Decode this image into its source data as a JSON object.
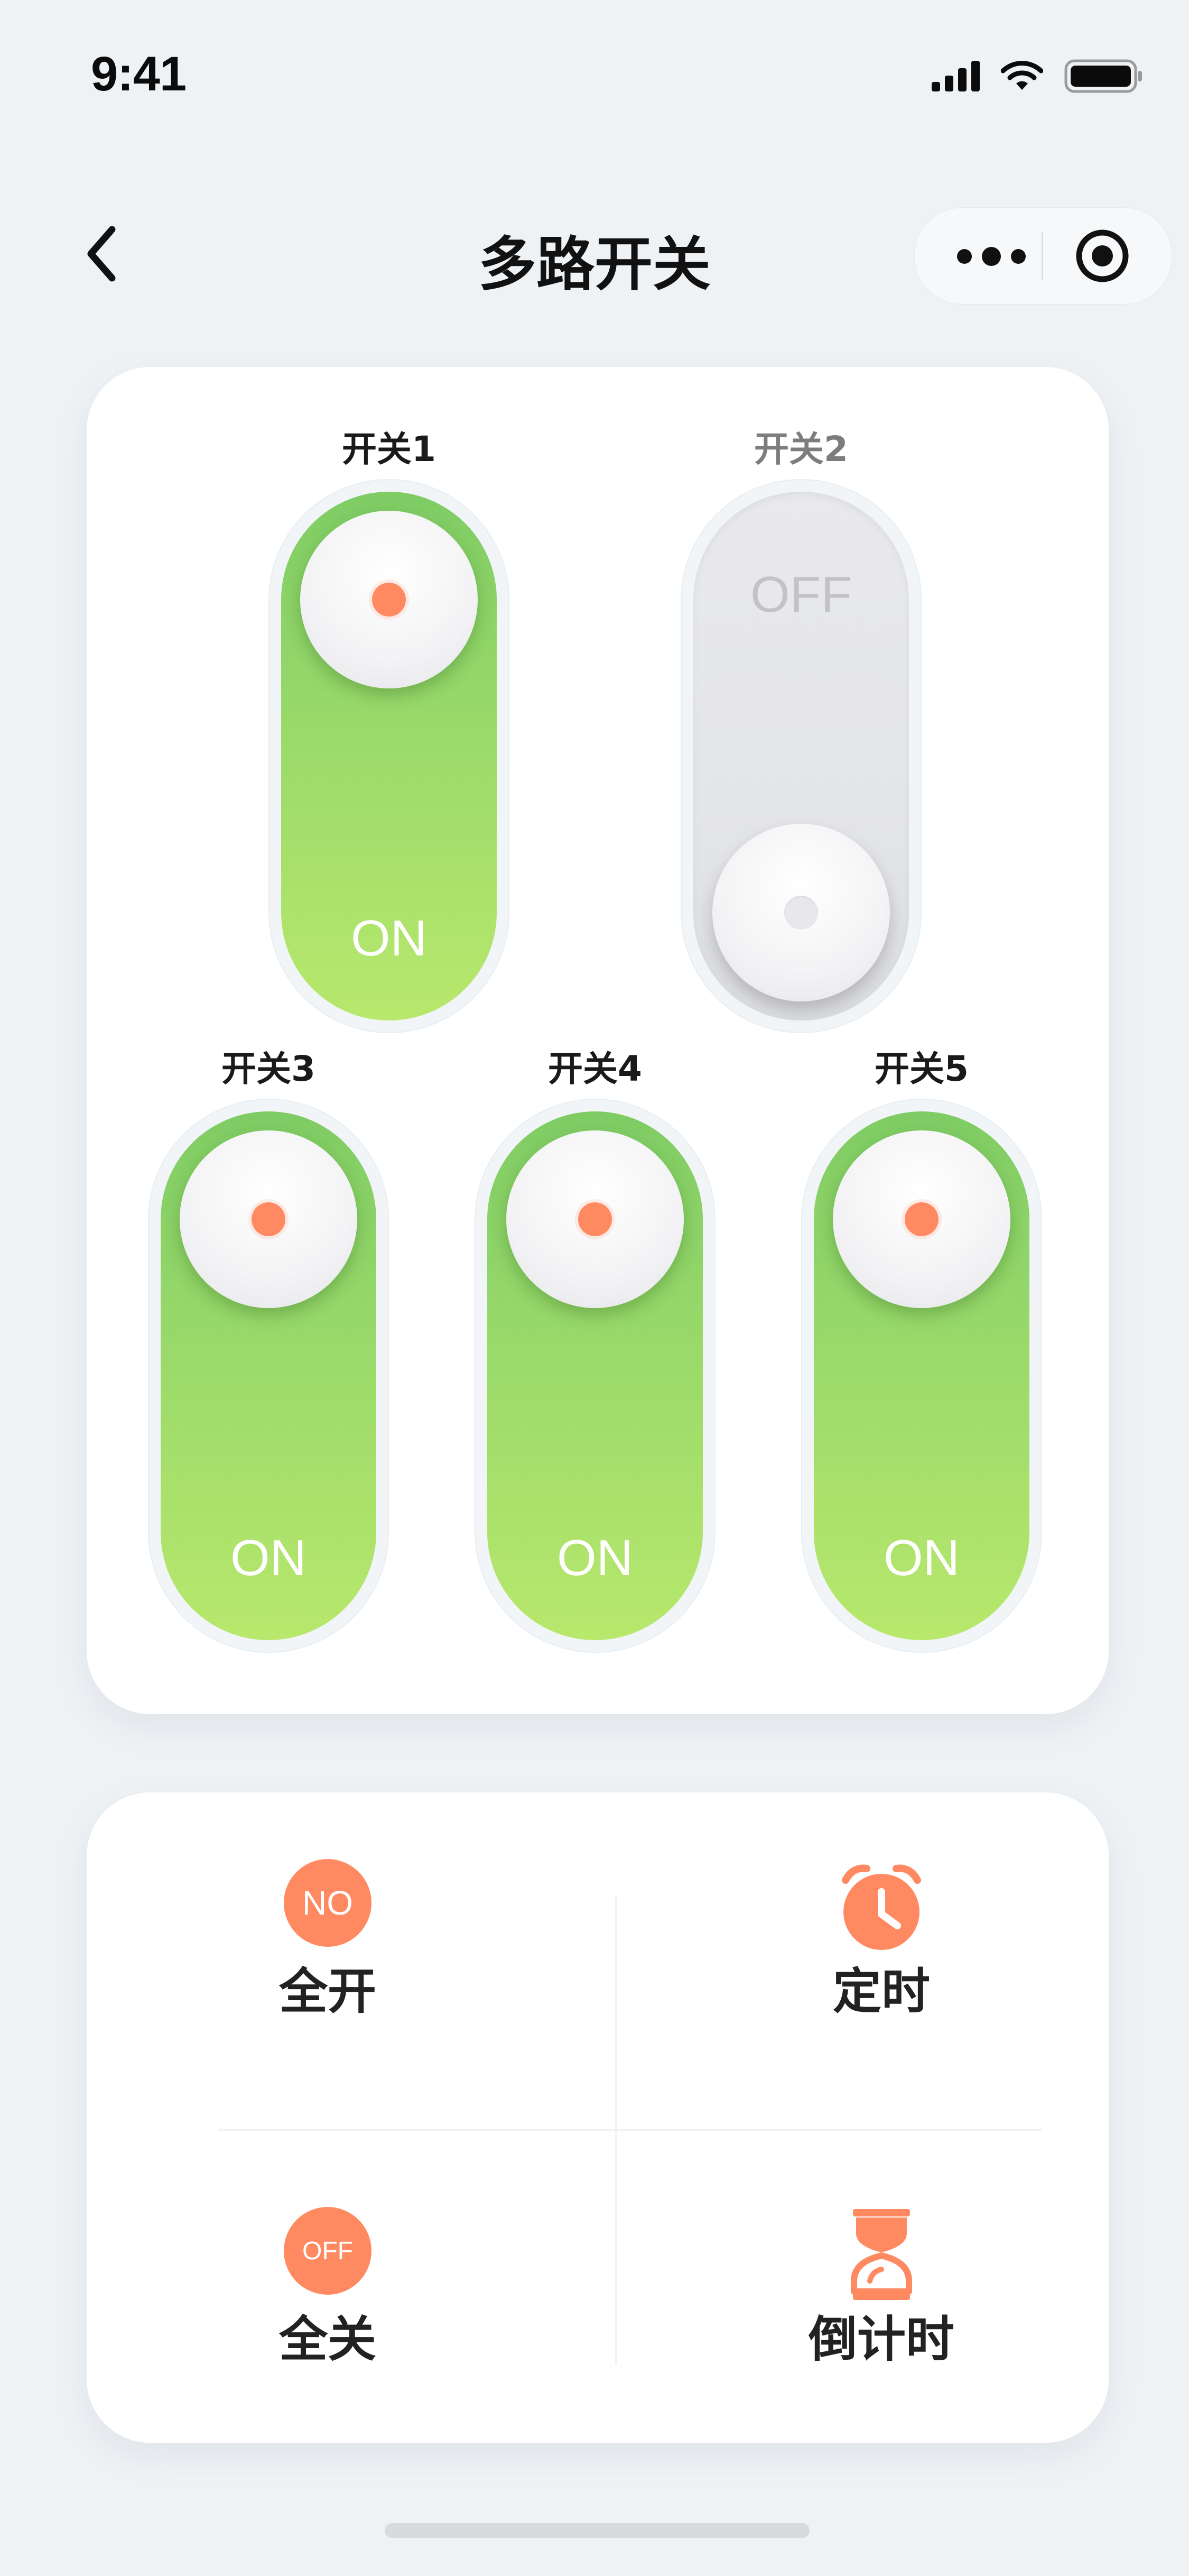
{
  "status_bar": {
    "time": "9:41"
  },
  "nav": {
    "title": "多路开关"
  },
  "switches": [
    {
      "label": "开关1",
      "state": "ON"
    },
    {
      "label": "开关2",
      "state": "OFF"
    },
    {
      "label": "开关3",
      "state": "ON"
    },
    {
      "label": "开关4",
      "state": "ON"
    },
    {
      "label": "开关5",
      "state": "ON"
    }
  ],
  "actions": {
    "all_on": {
      "icon_text": "NO",
      "label": "全开"
    },
    "timer": {
      "label": "定时"
    },
    "all_off": {
      "icon_text": "OFF",
      "label": "全关"
    },
    "countdown": {
      "label": "倒计时"
    }
  },
  "colors": {
    "accent": "#ff8a62",
    "on_track_top": "#7fcc64",
    "on_track_bottom": "#b8e86c",
    "off_track": "#e4e5e8",
    "background": "#eef2f5"
  }
}
